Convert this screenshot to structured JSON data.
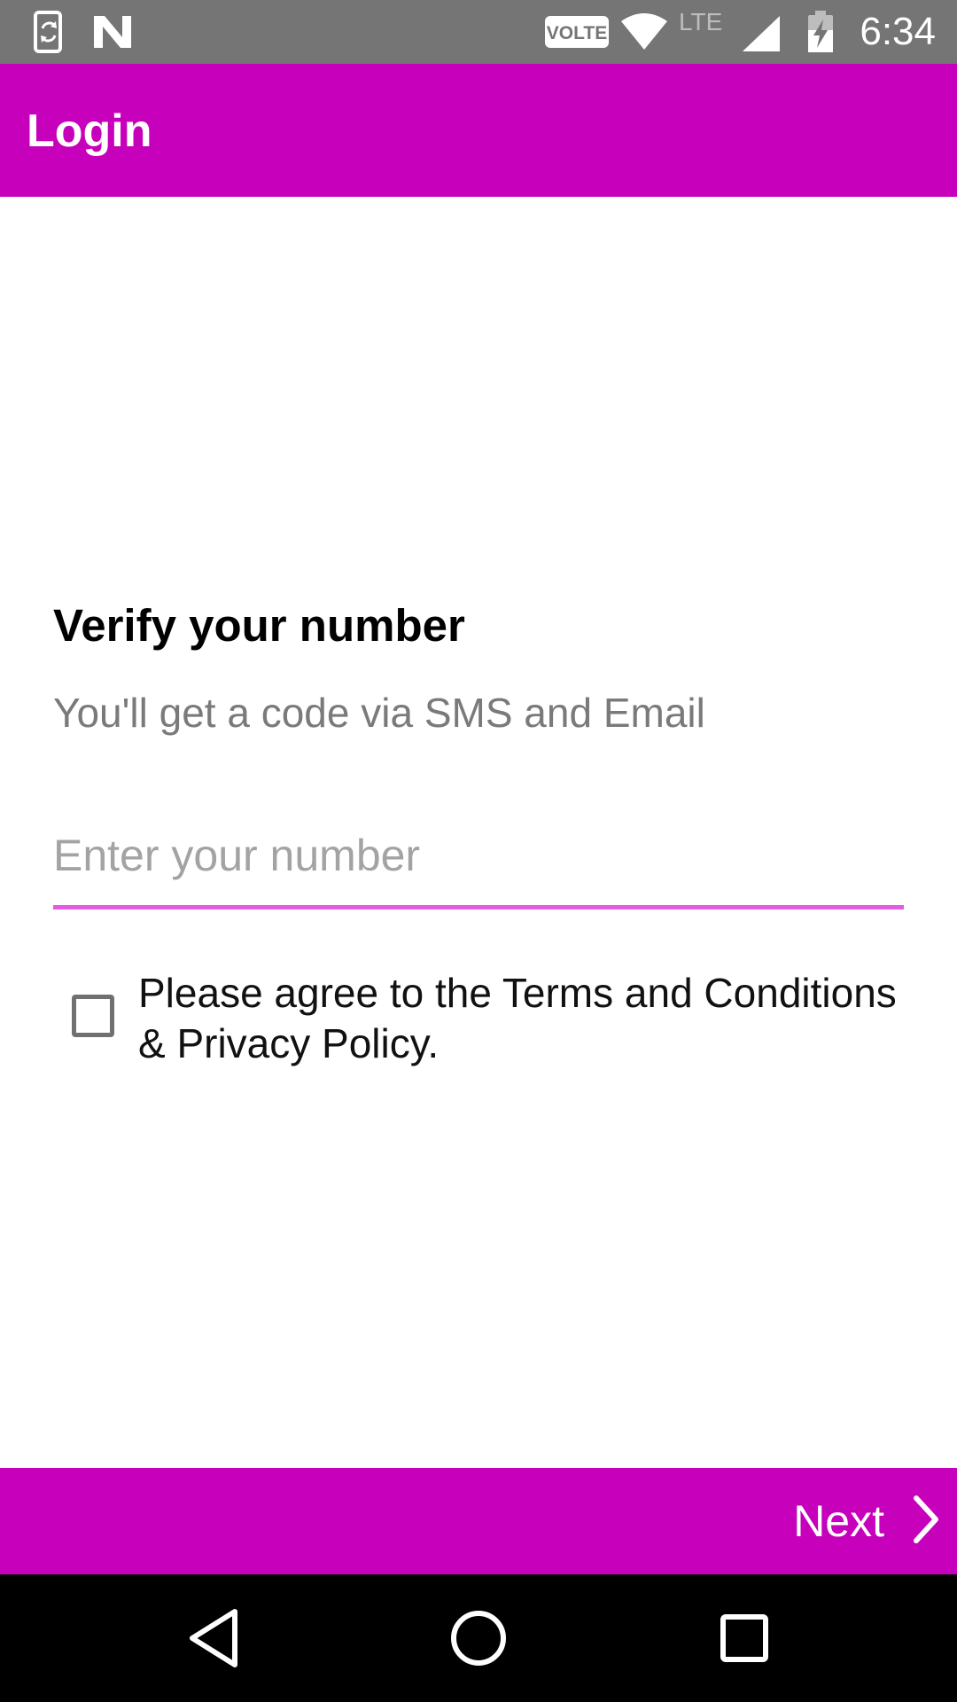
{
  "status_bar": {
    "time": "6:34",
    "volte_label": "VOLTE",
    "lte_label": "LTE",
    "icons": [
      "sync-phone-icon",
      "n-notification-icon",
      "volte-icon",
      "wifi-icon",
      "lte-icon",
      "signal-icon",
      "battery-charging-icon"
    ],
    "background_color": "#757575"
  },
  "app_bar": {
    "title": "Login",
    "background_color": "#c600bb"
  },
  "main": {
    "heading": "Verify your number",
    "subheading": "You'll get a code via SMS and Email",
    "number_input": {
      "value": "",
      "placeholder": "Enter your number",
      "underline_color": "#e55be0"
    },
    "terms_checkbox": {
      "checked": false,
      "label": "Please agree to the Terms and Conditions & Privacy Policy."
    }
  },
  "bottom_bar": {
    "next_label": "Next",
    "next_icon": "chevron-right-icon",
    "background_color": "#c600bb"
  },
  "nav_bar": {
    "buttons": [
      "back-icon",
      "home-icon",
      "recents-icon"
    ]
  }
}
